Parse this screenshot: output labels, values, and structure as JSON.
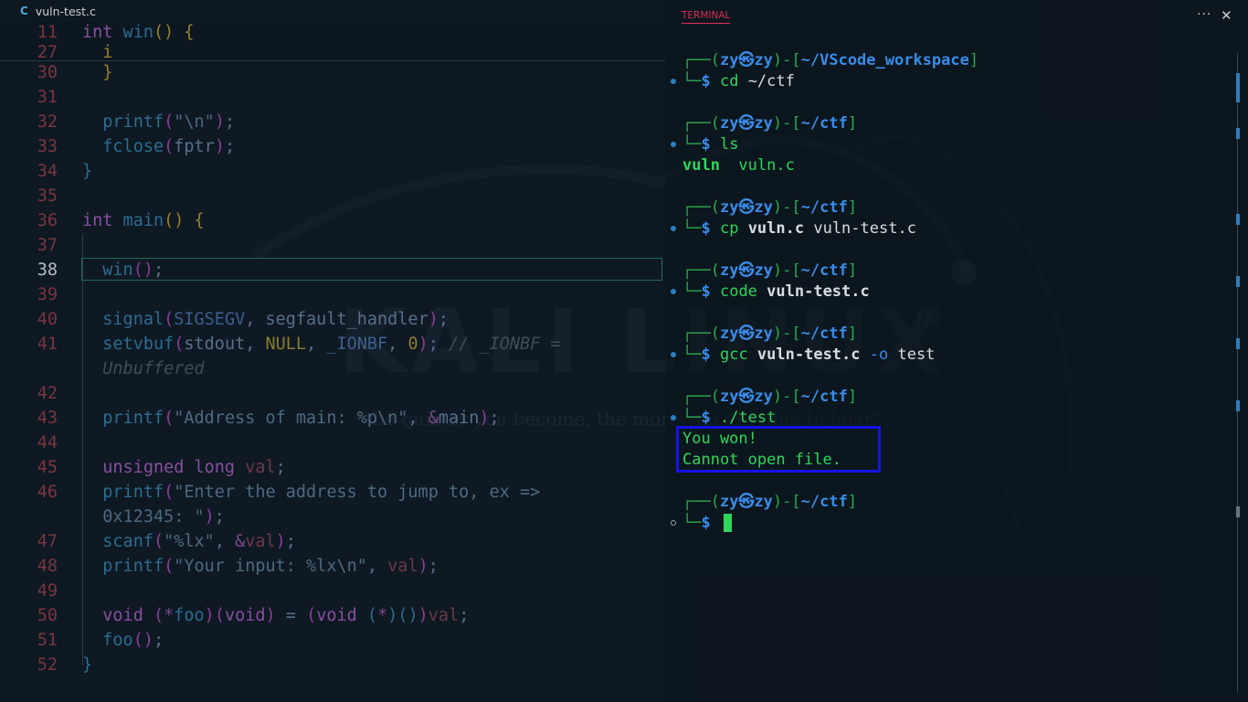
{
  "editor": {
    "tab": {
      "icon": "C",
      "label": "vuln-test.c"
    },
    "sticky": [
      {
        "num": "11",
        "tokens": [
          [
            "kw",
            "int"
          ],
          [
            "fn",
            " win"
          ],
          [
            "p1",
            "()"
          ],
          [
            "plain",
            " "
          ],
          [
            "p1",
            "{"
          ]
        ]
      },
      {
        "num": "27",
        "tokens": [
          [
            "plain",
            "  "
          ],
          [
            "p1",
            "i"
          ]
        ]
      }
    ],
    "lines": [
      {
        "num": "30",
        "tokens": [
          [
            "plain",
            "  "
          ],
          [
            "p1",
            "}"
          ]
        ]
      },
      {
        "num": "31",
        "tokens": []
      },
      {
        "num": "32",
        "tokens": [
          [
            "fn",
            "  printf"
          ],
          [
            "p2",
            "("
          ],
          [
            "str",
            "\"\\n\""
          ],
          [
            "p2",
            ")"
          ],
          [
            "plain",
            ";"
          ]
        ]
      },
      {
        "num": "33",
        "tokens": [
          [
            "fn",
            "  fclose"
          ],
          [
            "p2",
            "("
          ],
          [
            "plain",
            "fptr"
          ],
          [
            "p2",
            ")"
          ],
          [
            "plain",
            ";"
          ]
        ]
      },
      {
        "num": "34",
        "tokens": [
          [
            "p3",
            "}"
          ]
        ]
      },
      {
        "num": "35",
        "tokens": []
      },
      {
        "num": "36",
        "tokens": [
          [
            "kw",
            "int"
          ],
          [
            "fn",
            " main"
          ],
          [
            "p1",
            "()"
          ],
          [
            "plain",
            " "
          ],
          [
            "p1",
            "{"
          ]
        ]
      },
      {
        "num": "37",
        "tokens": []
      },
      {
        "num": "38",
        "active": true,
        "tokens": [
          [
            "fn",
            "  win"
          ],
          [
            "p2",
            "()"
          ],
          [
            "plain",
            ";"
          ]
        ]
      },
      {
        "num": "39",
        "tokens": []
      },
      {
        "num": "40",
        "tokens": [
          [
            "fn",
            "  signal"
          ],
          [
            "p2",
            "("
          ],
          [
            "macro",
            "SIGSEGV"
          ],
          [
            "plain",
            ", segfault_handler"
          ],
          [
            "p2",
            ")"
          ],
          [
            "plain",
            ";"
          ]
        ]
      },
      {
        "num": "41",
        "tokens": [
          [
            "fn",
            "  setvbuf"
          ],
          [
            "p2",
            "("
          ],
          [
            "plain",
            "stdout, "
          ],
          [
            "cn",
            "NULL"
          ],
          [
            "plain",
            ", "
          ],
          [
            "macro",
            "_IONBF"
          ],
          [
            "plain",
            ", "
          ],
          [
            "num",
            "0"
          ],
          [
            "p2",
            ")"
          ],
          [
            "plain",
            "; "
          ],
          [
            "cmt",
            "// _IONBF ="
          ]
        ]
      },
      {
        "num": "",
        "tokens": [
          [
            "cmt",
            "  Unbuffered"
          ]
        ]
      },
      {
        "num": "42",
        "tokens": []
      },
      {
        "num": "43",
        "tokens": [
          [
            "fn",
            "  printf"
          ],
          [
            "p2",
            "("
          ],
          [
            "str",
            "\"Address of main: %p\\n\""
          ],
          [
            "plain",
            ", "
          ],
          [
            "amp",
            "&"
          ],
          [
            "plain",
            "main"
          ],
          [
            "p2",
            ")"
          ],
          [
            "plain",
            ";"
          ]
        ]
      },
      {
        "num": "44",
        "tokens": []
      },
      {
        "num": "45",
        "tokens": [
          [
            "kw",
            "  unsigned long"
          ],
          [
            "var",
            " val"
          ],
          [
            "plain",
            ";"
          ]
        ]
      },
      {
        "num": "46",
        "tokens": [
          [
            "fn",
            "  printf"
          ],
          [
            "p2",
            "("
          ],
          [
            "str",
            "\"Enter the address to jump to, ex =>"
          ]
        ]
      },
      {
        "num": "",
        "tokens": [
          [
            "str",
            "  0x12345: \""
          ],
          [
            "p2",
            ")"
          ],
          [
            "plain",
            ";"
          ]
        ]
      },
      {
        "num": "47",
        "tokens": [
          [
            "fn",
            "  scanf"
          ],
          [
            "p2",
            "("
          ],
          [
            "str",
            "\"%lx\""
          ],
          [
            "plain",
            ", "
          ],
          [
            "amp",
            "&"
          ],
          [
            "var",
            "val"
          ],
          [
            "p2",
            ")"
          ],
          [
            "plain",
            ";"
          ]
        ]
      },
      {
        "num": "48",
        "tokens": [
          [
            "fn",
            "  printf"
          ],
          [
            "p2",
            "("
          ],
          [
            "str",
            "\"Your input: %lx\\n\""
          ],
          [
            "plain",
            ", "
          ],
          [
            "var",
            "val"
          ],
          [
            "p2",
            ")"
          ],
          [
            "plain",
            ";"
          ]
        ]
      },
      {
        "num": "49",
        "tokens": []
      },
      {
        "num": "50",
        "tokens": [
          [
            "kw",
            "  void"
          ],
          [
            "plain",
            " "
          ],
          [
            "p2",
            "("
          ],
          [
            "amp",
            "*"
          ],
          [
            "fn",
            "foo"
          ],
          [
            "p2",
            ")"
          ],
          [
            "p2",
            "("
          ],
          [
            "kw",
            "void"
          ],
          [
            "p2",
            ")"
          ],
          [
            "plain",
            " = "
          ],
          [
            "p2",
            "("
          ],
          [
            "kw",
            "void"
          ],
          [
            "plain",
            " "
          ],
          [
            "p3",
            "("
          ],
          [
            "amp",
            "*"
          ],
          [
            "p3",
            ")"
          ],
          [
            "p3",
            "()"
          ],
          [
            "p2",
            ")"
          ],
          [
            "var",
            "val"
          ],
          [
            "plain",
            ";"
          ]
        ]
      },
      {
        "num": "51",
        "tokens": [
          [
            "fn",
            "  foo"
          ],
          [
            "p2",
            "()"
          ],
          [
            "plain",
            ";"
          ]
        ]
      },
      {
        "num": "52",
        "tokens": [
          [
            "p3",
            "}"
          ]
        ]
      }
    ]
  },
  "watermark": {
    "title": "KALI LINUX",
    "tm": "TM",
    "quote": "“the quieter you become, the more you are able to hear”"
  },
  "terminal": {
    "tab_label": "TERMINAL",
    "more_icon": "···",
    "close_icon": "✕",
    "user": "zy",
    "host": "zy",
    "skull": "㉿",
    "blocks": [
      {
        "path": "~/VScode_workspace",
        "cmd": [
          [
            "cmd",
            "cd"
          ],
          [
            "arg",
            " ~/ctf"
          ]
        ],
        "output": []
      },
      {
        "path": "~/ctf",
        "cmd": [
          [
            "cmd",
            "ls"
          ]
        ],
        "output": [
          [
            [
              "outbold",
              "vuln"
            ],
            [
              "out",
              "  vuln.c"
            ]
          ]
        ]
      },
      {
        "path": "~/ctf",
        "cmd": [
          [
            "cmd",
            "cp"
          ],
          [
            "bold-arg",
            " vuln.c"
          ],
          [
            "arg",
            " vuln-test.c"
          ]
        ],
        "output": []
      },
      {
        "path": "~/ctf",
        "cmd": [
          [
            "cmd",
            "code"
          ],
          [
            "bold-arg",
            " vuln-test.c"
          ]
        ],
        "output": []
      },
      {
        "path": "~/ctf",
        "cmd": [
          [
            "cmd",
            "gcc"
          ],
          [
            "bold-arg",
            " vuln-test.c"
          ],
          [
            "opt",
            " -o"
          ],
          [
            "arg",
            " test"
          ]
        ],
        "output": []
      },
      {
        "path": "~/ctf",
        "cmd": [
          [
            "cmd",
            "./test"
          ]
        ],
        "output": [
          [
            [
              "out",
              "You won!"
            ]
          ],
          [
            [
              "out",
              "Cannot open file."
            ]
          ]
        ]
      },
      {
        "path": "~/ctf",
        "cmd": [],
        "output": [],
        "cursor": true
      }
    ]
  }
}
